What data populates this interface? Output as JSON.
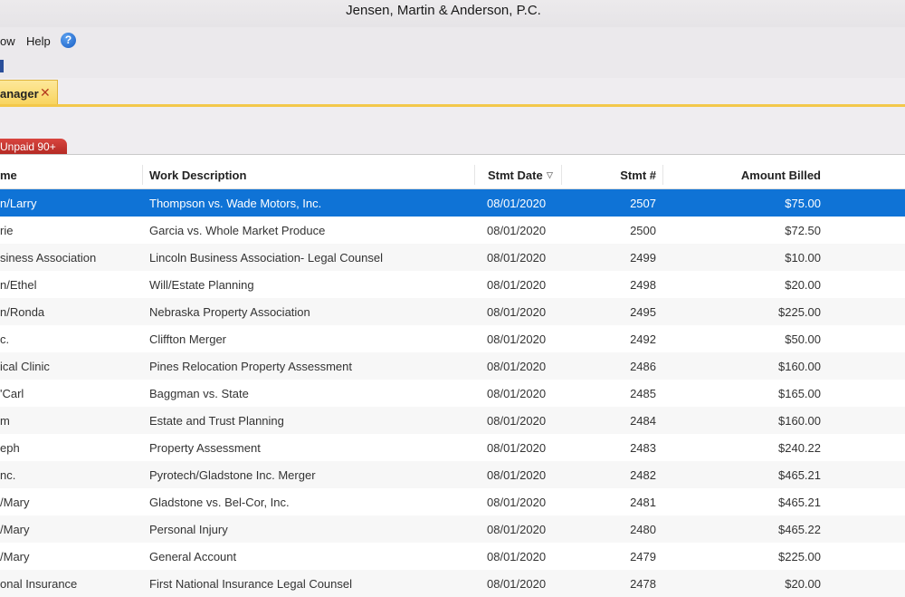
{
  "window": {
    "title": "Jensen, Martin & Anderson, P.C."
  },
  "menu": {
    "items": [
      "ow",
      "Help"
    ]
  },
  "document_tab": {
    "label": "anager",
    "close_glyph": "✕"
  },
  "subtab": {
    "label": "Unpaid 90+"
  },
  "table": {
    "columns": [
      "me",
      "Work Description",
      "Stmt Date",
      "Stmt #",
      "Amount Billed"
    ],
    "sort_indicator": "▽",
    "rows": [
      {
        "name": "n/Larry",
        "work": "Thompson vs. Wade Motors, Inc.",
        "date": "08/01/2020",
        "num": "2507",
        "amount": "$75.00",
        "selected": true
      },
      {
        "name": "rie",
        "work": "Garcia vs. Whole Market Produce",
        "date": "08/01/2020",
        "num": "2500",
        "amount": "$72.50"
      },
      {
        "name": "siness Association",
        "work": "Lincoln Business Association- Legal Counsel",
        "date": "08/01/2020",
        "num": "2499",
        "amount": "$10.00"
      },
      {
        "name": "n/Ethel",
        "work": "Will/Estate Planning",
        "date": "08/01/2020",
        "num": "2498",
        "amount": "$20.00"
      },
      {
        "name": "n/Ronda",
        "work": "Nebraska Property Association",
        "date": "08/01/2020",
        "num": "2495",
        "amount": "$225.00"
      },
      {
        "name": "c.",
        "work": "Cliffton Merger",
        "date": "08/01/2020",
        "num": "2492",
        "amount": "$50.00"
      },
      {
        "name": "ical Clinic",
        "work": "Pines Relocation Property Assessment",
        "date": "08/01/2020",
        "num": "2486",
        "amount": "$160.00"
      },
      {
        "name": "'Carl",
        "work": "Baggman vs. State",
        "date": "08/01/2020",
        "num": "2485",
        "amount": "$165.00"
      },
      {
        "name": "m",
        "work": "Estate and Trust Planning",
        "date": "08/01/2020",
        "num": "2484",
        "amount": "$160.00"
      },
      {
        "name": "eph",
        "work": "Property Assessment",
        "date": "08/01/2020",
        "num": "2483",
        "amount": "$240.22"
      },
      {
        "name": "nc.",
        "work": "Pyrotech/Gladstone Inc. Merger",
        "date": "08/01/2020",
        "num": "2482",
        "amount": "$465.21"
      },
      {
        "name": "/Mary",
        "work": "Gladstone vs. Bel-Cor, Inc.",
        "date": "08/01/2020",
        "num": "2481",
        "amount": "$465.21"
      },
      {
        "name": "/Mary",
        "work": "Personal Injury",
        "date": "08/01/2020",
        "num": "2480",
        "amount": "$465.22"
      },
      {
        "name": "/Mary",
        "work": "General Account",
        "date": "08/01/2020",
        "num": "2479",
        "amount": "$225.00"
      },
      {
        "name": "onal Insurance",
        "work": "First National Insurance Legal Counsel",
        "date": "08/01/2020",
        "num": "2478",
        "amount": "$20.00"
      }
    ]
  },
  "colors": {
    "selection": "#0f73d6",
    "tab_accent": "#f3c84a",
    "subtab": "#c0302a"
  },
  "icons": [
    "help-icon",
    "close-icon",
    "sort-icon",
    "toolbar-icon"
  ]
}
